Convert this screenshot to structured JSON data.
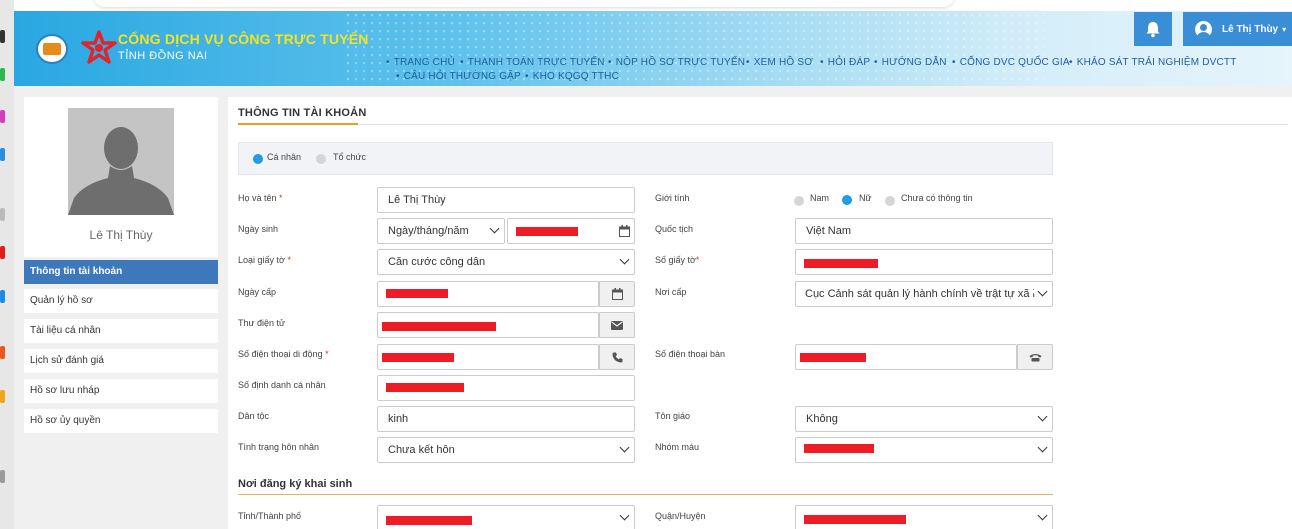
{
  "header": {
    "brand_line1": "CỔNG DỊCH VỤ CÔNG TRỰC TUYẾN",
    "brand_line2": "TỈNH ĐỒNG NAI",
    "nav": [
      "TRANG CHỦ",
      "THANH TOÁN TRỰC TUYẾN",
      "NỘP HỒ SƠ TRỰC TUYẾN",
      "XEM HỒ SƠ",
      "HỎI ĐÁP",
      "HƯỚNG DẪN",
      "CỔNG DVC QUỐC GIA",
      "KHẢO SÁT TRẢI NGHIỆM DVCTT",
      "CÂU HỎI THƯỜNG GẶP",
      "KHO KQGQ TTHC"
    ],
    "user_name": "Lê Thị Thùy",
    "user_caret": "▾"
  },
  "sidebar": {
    "name": "Lê Thị Thùy",
    "items": [
      "Thông tin tài khoản",
      "Quản lý hồ sơ",
      "Tài liệu cá nhân",
      "Lịch sử đánh giá",
      "Hồ sơ lưu nháp",
      "Hồ sơ ủy quyền"
    ],
    "active_index": 0
  },
  "main": {
    "title": "THÔNG TIN TÀI KHOẢN",
    "account_type": {
      "options": [
        "Cá nhân",
        "Tổ chức"
      ],
      "selected": "Cá nhân"
    },
    "labels": {
      "full_name": "Họ và tên",
      "dob": "Ngày sinh",
      "id_type": "Loại giấy tờ",
      "issue_date": "Ngày cấp",
      "email": "Thư điện tử",
      "mobile": "Số điện thoại di động",
      "personal_id": "Số định danh cá nhân",
      "ethnicity": "Dân tộc",
      "marital": "Tình trạng hôn nhân",
      "gender": "Giới tính",
      "nationality": "Quốc tịch",
      "id_number": "Số giấy tờ",
      "issue_place": "Nơi cấp",
      "landline": "Số điện thoại bàn",
      "religion": "Tôn giáo",
      "blood": "Nhóm máu",
      "province": "Tỉnh/Thành phố",
      "district": "Quận/Huyện"
    },
    "required_mark": "*",
    "values": {
      "full_name": "Lê Thị Thùy",
      "dob_format": "Ngày/tháng/năm",
      "id_type": "Căn cước công dân",
      "ethnicity": "kinh",
      "marital": "Chưa kết hôn",
      "nationality": "Việt Nam",
      "issue_place": "Cục Cảnh sát quản lý hành chính về trật tự xã hội",
      "religion": "Không"
    },
    "gender": {
      "options": [
        "Nam",
        "Nữ",
        "Chưa có thông tin"
      ],
      "selected": "Nữ"
    },
    "birth_section_title": "Nơi đăng ký khai sinh"
  },
  "colors": {
    "accent": "#3a8ed6",
    "sidebar_active": "#3d78ba",
    "redaction": "#ee1c25",
    "tab_underline": "#ef9a2a"
  }
}
